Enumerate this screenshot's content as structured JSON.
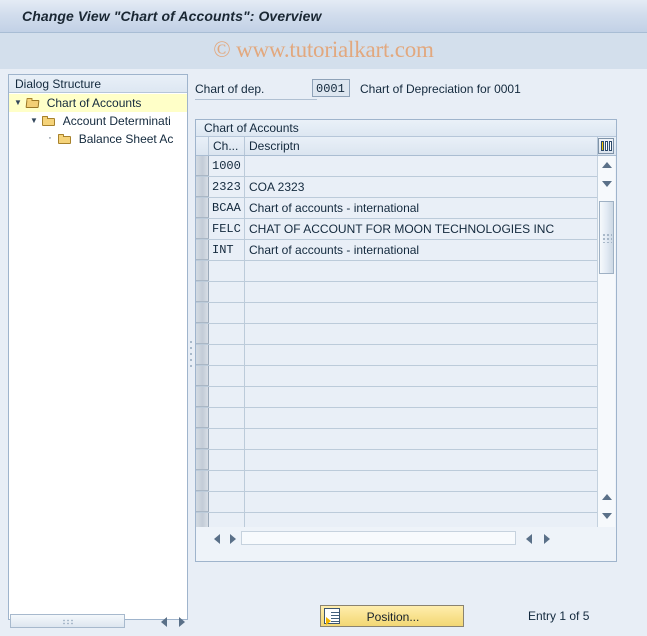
{
  "window": {
    "title": "Change View \"Chart of Accounts\": Overview",
    "watermark": "© www.tutorialkart.com"
  },
  "sidebar": {
    "header": "Dialog Structure",
    "items": [
      {
        "label": "Chart of Accounts",
        "icon": "folder-open-icon",
        "twisty": "▼",
        "selected": true,
        "level": 0
      },
      {
        "label": "Account Determinati",
        "icon": "folder-icon",
        "twisty": "▼",
        "selected": false,
        "level": 1
      },
      {
        "label": "Balance Sheet Ac",
        "icon": "folder-icon",
        "twisty": "·",
        "selected": false,
        "level": 2
      }
    ]
  },
  "form": {
    "chart_of_dep_label": "Chart of dep.",
    "chart_of_dep_value": "0001",
    "chart_of_dep_description": "Chart of Depreciation for 0001"
  },
  "table": {
    "caption": "Chart of Accounts",
    "columns": [
      {
        "key": "code",
        "label": "Ch..."
      },
      {
        "key": "desc",
        "label": "Descriptn"
      }
    ],
    "rows": [
      {
        "code": "1000",
        "desc": ""
      },
      {
        "code": "2323",
        "desc": "COA 2323"
      },
      {
        "code": "BCAA",
        "desc": "Chart of accounts - international"
      },
      {
        "code": "FELC",
        "desc": "CHAT OF ACCOUNT FOR MOON TECHNOLOGIES INC"
      },
      {
        "code": "INT",
        "desc": "Chart of accounts - international"
      }
    ],
    "empty_row_count": 13,
    "config_icon": "table-settings-icon"
  },
  "footer": {
    "position_button_label": "Position...",
    "entry_status": "Entry 1 of 5"
  },
  "colors": {
    "title_bar": "#c9d7e8",
    "accent_selected_row": "#ffffc8",
    "button_yellow": "#f8e18c",
    "watermark": "#e2a87e",
    "panel_background": "#e8eef6"
  }
}
